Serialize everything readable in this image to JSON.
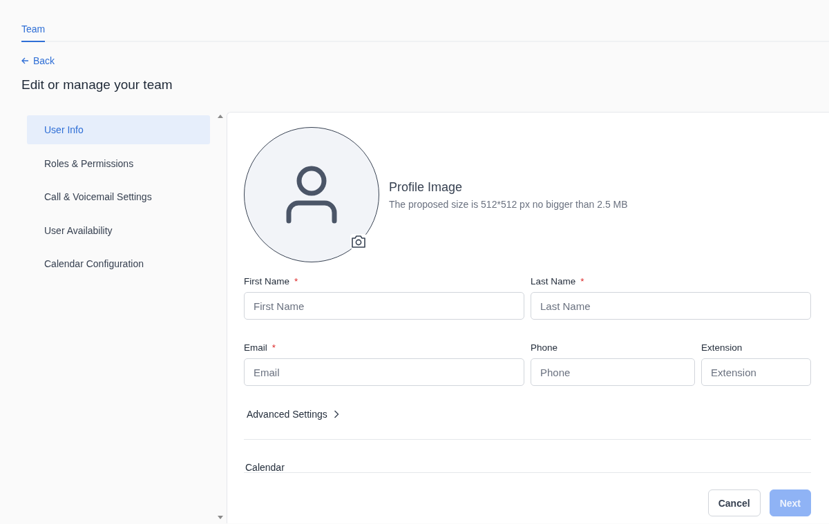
{
  "tabs": [
    {
      "label": "Team",
      "selected": true
    }
  ],
  "back_link": {
    "label": "Back"
  },
  "page_title": "Edit or manage your team",
  "sidebar": {
    "items": [
      {
        "label": "User Info",
        "selected": true
      },
      {
        "label": "Roles & Permissions",
        "selected": false
      },
      {
        "label": "Call & Voicemail Settings",
        "selected": false
      },
      {
        "label": "User Availability",
        "selected": false
      },
      {
        "label": "Calendar Configuration",
        "selected": false
      }
    ]
  },
  "profile_image": {
    "title": "Profile Image",
    "hint": "The proposed size is 512*512 px no bigger than 2.5 MB"
  },
  "required_marker": "*",
  "fields": [
    {
      "label": "First Name",
      "placeholder": "First Name",
      "required": true
    },
    {
      "label": "Last Name",
      "placeholder": "Last Name",
      "required": true
    },
    {
      "label": "Email",
      "placeholder": "Email",
      "required": true
    },
    {
      "label": "Phone",
      "placeholder": "Phone",
      "required": false
    },
    {
      "label": "Extension",
      "placeholder": "Extension",
      "required": false
    }
  ],
  "advanced_settings": {
    "label": "Advanced Settings",
    "expanded": false
  },
  "calendar_section": {
    "label": "Calendar"
  },
  "buttons": [
    {
      "label": "Cancel",
      "kind": "secondary",
      "disabled": false
    },
    {
      "label": "Next",
      "kind": "primary",
      "disabled": true
    }
  ]
}
